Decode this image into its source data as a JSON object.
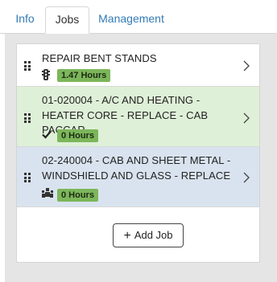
{
  "tabs": [
    {
      "label": "Info",
      "active": false
    },
    {
      "label": "Jobs",
      "active": true
    },
    {
      "label": "Management",
      "active": false
    }
  ],
  "jobs": [
    {
      "title": "REPAIR BENT STANDS",
      "status_icon": "traffic-light-icon",
      "hours": "1.47 Hours",
      "background": "#ffffff"
    },
    {
      "title": "01-020004 - A/C AND HEATING - HEATER CORE - REPLACE - CAB PACCAR",
      "status_icon": "checkmark-icon",
      "hours": "0 Hours",
      "background": "#dff0d8"
    },
    {
      "title": "02-240004 - CAB AND SHEET METAL - WINDSHIELD AND GLASS - REPLACE",
      "status_icon": "people-icon",
      "hours": "0 Hours",
      "background": "#d9e3ef"
    }
  ],
  "add_job_label": "Add Job",
  "colors": {
    "link": "#337ab7",
    "badge": "#7cb65a",
    "panel": "#e5e5e5"
  }
}
